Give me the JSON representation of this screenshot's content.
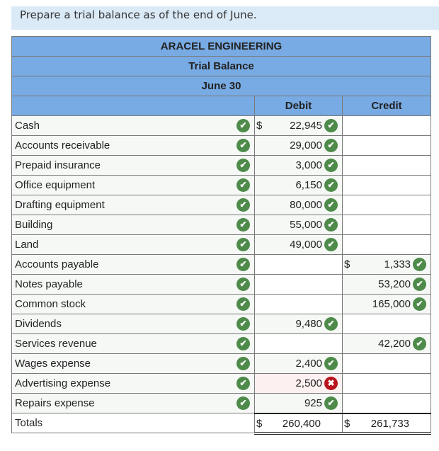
{
  "prompt": "Prepare a trial balance as of the end of June.",
  "header": {
    "company": "ARACEL ENGINEERING",
    "report": "Trial Balance",
    "date": "June 30",
    "debit_label": "Debit",
    "credit_label": "Credit"
  },
  "rows": [
    {
      "account": "Cash",
      "debit": "22,945",
      "debit_currency": "$",
      "credit": "",
      "credit_currency": ""
    },
    {
      "account": "Accounts receivable",
      "debit": "29,000",
      "credit": ""
    },
    {
      "account": "Prepaid insurance",
      "debit": "3,000",
      "credit": ""
    },
    {
      "account": "Office equipment",
      "debit": "6,150",
      "credit": ""
    },
    {
      "account": "Drafting equipment",
      "debit": "80,000",
      "credit": ""
    },
    {
      "account": "Building",
      "debit": "55,000",
      "credit": ""
    },
    {
      "account": "Land",
      "debit": "49,000",
      "credit": ""
    },
    {
      "account": "Accounts payable",
      "debit": "",
      "credit": "1,333",
      "credit_currency": "$"
    },
    {
      "account": "Notes payable",
      "debit": "",
      "credit": "53,200"
    },
    {
      "account": "Common stock",
      "debit": "",
      "credit": "165,000"
    },
    {
      "account": "Dividends",
      "debit": "9,480",
      "credit": ""
    },
    {
      "account": "Services revenue",
      "debit": "",
      "credit": "42,200"
    },
    {
      "account": "Wages expense",
      "debit": "2,400",
      "credit": ""
    },
    {
      "account": "Advertising expense",
      "debit": "2,500",
      "credit": "",
      "debit_status": "incorrect"
    },
    {
      "account": "Repairs expense",
      "debit": "925",
      "credit": ""
    }
  ],
  "totals": {
    "label": "Totals",
    "debit_currency": "$",
    "debit": "260,400",
    "credit_currency": "$",
    "credit": "261,733"
  },
  "icons": {
    "correct": "✔",
    "incorrect": "✖"
  },
  "colors": {
    "header_bg": "#78aae3",
    "prompt_bg": "#dbeaf7",
    "correct": "#4e8b4a",
    "incorrect": "#b8141b"
  }
}
